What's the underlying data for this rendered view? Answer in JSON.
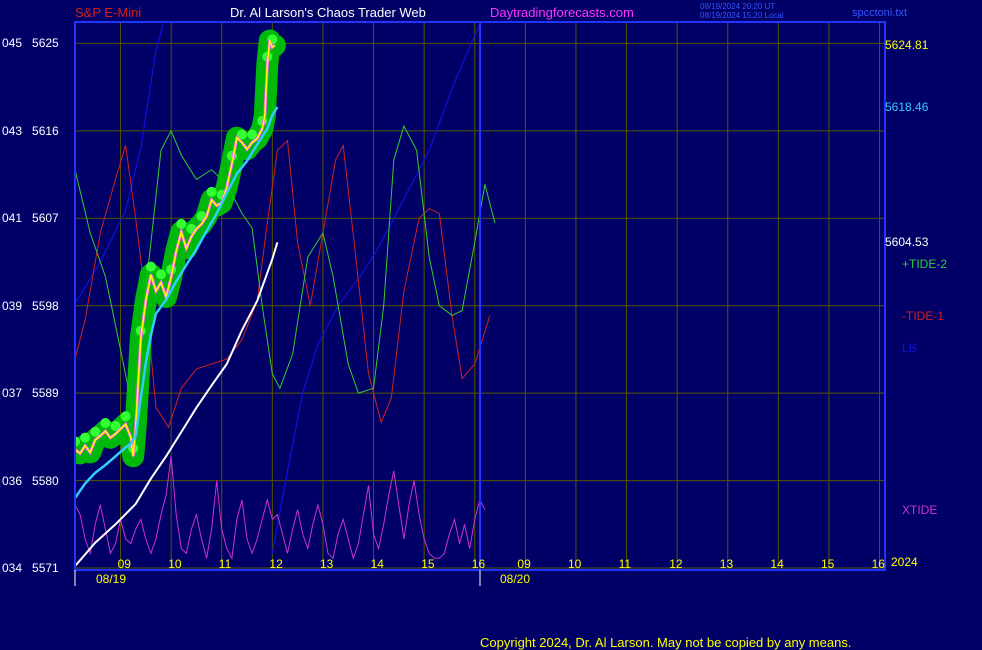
{
  "header": {
    "symbol": "S&P E-Mini",
    "title": "Dr. Al Larson's Chaos Trader Web",
    "site": "Daytradingforecasts.com",
    "time_utc": "08/19/2024 20:20 UT",
    "time_local": "08/19/2024 15:20 Local",
    "file": "spcctoni.txt"
  },
  "footer": {
    "copyright": "Copyright 2024, Dr. Al Larson. May not be copied by any means."
  },
  "colors": {
    "background": "#000066",
    "frame": "#2233ff",
    "grid": "#555500",
    "price": "#ffff00",
    "price_band": "#00cc00",
    "fast_ma": "#33ccff",
    "slow_ma": "#ffffff",
    "tide_plus2": "#33cc33",
    "tide_minus1": "#cc2222",
    "lb": "#1111dd",
    "xtide": "#cc33cc"
  },
  "chart_data": {
    "type": "line",
    "title": "S&P E-Mini",
    "ylim": [
      5571,
      5627
    ],
    "y_ticks": [
      {
        "left": "045",
        "right": "5625",
        "value": 5625
      },
      {
        "left": "043",
        "right": "5616",
        "value": 5616
      },
      {
        "left": "041",
        "right": "5607",
        "value": 5607
      },
      {
        "left": "039",
        "right": "5598",
        "value": 5598
      },
      {
        "left": "037",
        "right": "5589",
        "value": 5589
      },
      {
        "left": "036",
        "right": "5580",
        "value": 5580
      },
      {
        "left": "034",
        "right": "5571",
        "value": 5571
      }
    ],
    "x_hours": [
      "09",
      "10",
      "11",
      "12",
      "13",
      "14",
      "15",
      "16",
      "09",
      "10",
      "11",
      "12",
      "13",
      "14",
      "15",
      "16"
    ],
    "dates": [
      "08/19",
      "08/20"
    ],
    "year": "2024",
    "last_values": [
      {
        "text": "5624.81",
        "color": "#ffff00",
        "value": 5624.81
      },
      {
        "text": "5618.46",
        "color": "#33ccff",
        "value": 5618.46
      },
      {
        "text": "5604.53",
        "color": "#ffffff",
        "value": 5604.53
      }
    ],
    "series_labels": [
      {
        "text": "+TIDE-2",
        "color": "#33cc33"
      },
      {
        "text": "-TIDE-1",
        "color": "#cc2222"
      },
      {
        "text": "LB",
        "color": "#1111dd"
      },
      {
        "text": "XTIDE",
        "color": "#cc33cc"
      }
    ],
    "price": [
      [
        0,
        5583.2
      ],
      [
        0.1,
        5582.8
      ],
      [
        0.2,
        5583.6
      ],
      [
        0.3,
        5582.9
      ],
      [
        0.4,
        5584.2
      ],
      [
        0.5,
        5584.6
      ],
      [
        0.6,
        5585.1
      ],
      [
        0.7,
        5584.4
      ],
      [
        0.8,
        5584.8
      ],
      [
        0.9,
        5585.3
      ],
      [
        1.0,
        5585.8
      ],
      [
        1.1,
        5584.5
      ],
      [
        1.15,
        5582.5
      ],
      [
        1.2,
        5585.6
      ],
      [
        1.3,
        5594.6
      ],
      [
        1.4,
        5598.5
      ],
      [
        1.5,
        5601.2
      ],
      [
        1.6,
        5599.5
      ],
      [
        1.7,
        5600.4
      ],
      [
        1.8,
        5598.9
      ],
      [
        1.9,
        5600.9
      ],
      [
        2.0,
        5603.6
      ],
      [
        2.1,
        5605.6
      ],
      [
        2.2,
        5603.9
      ],
      [
        2.3,
        5605.1
      ],
      [
        2.4,
        5605.9
      ],
      [
        2.5,
        5606.4
      ],
      [
        2.6,
        5607.2
      ],
      [
        2.7,
        5608.9
      ],
      [
        2.8,
        5608.3
      ],
      [
        2.9,
        5608.6
      ],
      [
        3.0,
        5610.2
      ],
      [
        3.1,
        5612.6
      ],
      [
        3.2,
        5615.3
      ],
      [
        3.3,
        5614.8
      ],
      [
        3.4,
        5614.1
      ],
      [
        3.5,
        5614.8
      ],
      [
        3.6,
        5615.2
      ],
      [
        3.7,
        5616.2
      ],
      [
        3.75,
        5617.5
      ],
      [
        3.8,
        5622.8
      ],
      [
        3.85,
        5625.3
      ],
      [
        3.9,
        5624.6
      ],
      [
        3.95,
        5624.8
      ]
    ],
    "fast_ma": [
      [
        0,
        5578.2
      ],
      [
        0.2,
        5579.7
      ],
      [
        0.4,
        5580.8
      ],
      [
        0.6,
        5581.6
      ],
      [
        0.8,
        5582.5
      ],
      [
        1.0,
        5583.4
      ],
      [
        1.1,
        5583.8
      ],
      [
        1.2,
        5584.6
      ],
      [
        1.3,
        5588.5
      ],
      [
        1.4,
        5592.1
      ],
      [
        1.5,
        5595.0
      ],
      [
        1.6,
        5597.2
      ],
      [
        1.8,
        5598.6
      ],
      [
        2.0,
        5600.5
      ],
      [
        2.2,
        5602.2
      ],
      [
        2.4,
        5603.8
      ],
      [
        2.6,
        5605.7
      ],
      [
        2.8,
        5607.5
      ],
      [
        3.0,
        5609.6
      ],
      [
        3.2,
        5611.6
      ],
      [
        3.4,
        5612.9
      ],
      [
        3.6,
        5614.6
      ],
      [
        3.8,
        5616.2
      ],
      [
        3.9,
        5617.6
      ],
      [
        4.0,
        5618.46
      ]
    ],
    "slow_ma": [
      [
        0,
        5571.2
      ],
      [
        0.4,
        5573.6
      ],
      [
        0.8,
        5575.5
      ],
      [
        1.2,
        5577.6
      ],
      [
        1.5,
        5580.2
      ],
      [
        1.8,
        5582.5
      ],
      [
        2.1,
        5585.0
      ],
      [
        2.4,
        5587.5
      ],
      [
        2.7,
        5589.8
      ],
      [
        3.0,
        5592.0
      ],
      [
        3.3,
        5595.5
      ],
      [
        3.6,
        5598.5
      ],
      [
        3.9,
        5602.8
      ],
      [
        4.0,
        5604.53
      ]
    ],
    "lb": [
      [
        0,
        5598.2
      ],
      [
        0.5,
        5602.5
      ],
      [
        1.0,
        5607.8
      ],
      [
        1.3,
        5614.2
      ],
      [
        1.6,
        5624.3
      ],
      [
        2.0,
        5632.0
      ],
      [
        2.4,
        5638.0
      ],
      [
        2.7,
        5644.0
      ],
      [
        3.3,
        5651.0
      ],
      [
        3.6,
        5657.0
      ],
      [
        3.9,
        5662.0
      ],
      [
        3.9,
        5572.5
      ],
      [
        4.2,
        5581.0
      ],
      [
        4.5,
        5589.0
      ],
      [
        4.8,
        5594.0
      ],
      [
        5.2,
        5598.0
      ],
      [
        5.7,
        5601.5
      ],
      [
        6.0,
        5604.0
      ],
      [
        6.3,
        5607.0
      ],
      [
        6.6,
        5610.0
      ],
      [
        7.0,
        5614.0
      ],
      [
        7.5,
        5621.0
      ],
      [
        8.0,
        5627.0
      ]
    ],
    "tide_plus2": [
      [
        0,
        5612.0
      ],
      [
        0.3,
        5605.5
      ],
      [
        0.6,
        5601.0
      ],
      [
        0.9,
        5593.5
      ],
      [
        1.15,
        5587.0
      ],
      [
        1.3,
        5595.5
      ],
      [
        1.5,
        5604.5
      ],
      [
        1.7,
        5614.0
      ],
      [
        1.9,
        5616.0
      ],
      [
        2.1,
        5613.5
      ],
      [
        2.4,
        5611.0
      ],
      [
        2.7,
        5612.0
      ],
      [
        3.0,
        5610.5
      ],
      [
        3.3,
        5607.5
      ],
      [
        3.5,
        5606.0
      ],
      [
        3.7,
        5598.0
      ],
      [
        3.9,
        5591.0
      ],
      [
        4.05,
        5589.5
      ],
      [
        4.3,
        5593.0
      ],
      [
        4.6,
        5603.0
      ],
      [
        4.9,
        5605.5
      ],
      [
        5.1,
        5601.0
      ],
      [
        5.4,
        5592.0
      ],
      [
        5.6,
        5589.0
      ],
      [
        5.9,
        5589.5
      ],
      [
        6.1,
        5598.0
      ],
      [
        6.3,
        5613.0
      ],
      [
        6.5,
        5616.5
      ],
      [
        6.75,
        5614.0
      ],
      [
        7.0,
        5603.0
      ],
      [
        7.2,
        5598.0
      ],
      [
        7.45,
        5597.0
      ],
      [
        7.65,
        5597.5
      ],
      [
        7.9,
        5604.5
      ],
      [
        8.1,
        5610.5
      ],
      [
        8.3,
        5606.5
      ]
    ],
    "tide_minus1": [
      [
        0,
        5592.5
      ],
      [
        0.2,
        5596.5
      ],
      [
        0.5,
        5605.5
      ],
      [
        0.8,
        5611.0
      ],
      [
        1.0,
        5614.5
      ],
      [
        1.2,
        5607.0
      ],
      [
        1.4,
        5598.5
      ],
      [
        1.6,
        5587.5
      ],
      [
        1.85,
        5585.5
      ],
      [
        2.1,
        5589.5
      ],
      [
        2.4,
        5591.5
      ],
      [
        2.7,
        5592.0
      ],
      [
        3.0,
        5592.5
      ],
      [
        3.3,
        5594.5
      ],
      [
        3.6,
        5598.5
      ],
      [
        3.8,
        5606.5
      ],
      [
        4.0,
        5614.0
      ],
      [
        4.2,
        5615.0
      ],
      [
        4.4,
        5604.5
      ],
      [
        4.65,
        5598.0
      ],
      [
        4.9,
        5605.5
      ],
      [
        5.15,
        5613.0
      ],
      [
        5.3,
        5614.5
      ],
      [
        5.55,
        5603.0
      ],
      [
        5.8,
        5591.0
      ],
      [
        6.05,
        5586.0
      ],
      [
        6.25,
        5588.5
      ],
      [
        6.5,
        5599.5
      ],
      [
        6.8,
        5607.0
      ],
      [
        7.0,
        5608.0
      ],
      [
        7.2,
        5607.5
      ],
      [
        7.45,
        5597.0
      ],
      [
        7.65,
        5590.5
      ],
      [
        7.9,
        5592.0
      ],
      [
        8.2,
        5597.0
      ]
    ],
    "xtide": [
      [
        0,
        5577.5
      ],
      [
        0.1,
        5576.5
      ],
      [
        0.2,
        5574.0
      ],
      [
        0.3,
        5572.5
      ],
      [
        0.4,
        5575.5
      ],
      [
        0.5,
        5577.5
      ],
      [
        0.6,
        5575.0
      ],
      [
        0.7,
        5572.5
      ],
      [
        0.8,
        5573.5
      ],
      [
        0.9,
        5576.0
      ],
      [
        1.0,
        5574.0
      ],
      [
        1.1,
        5573.5
      ],
      [
        1.2,
        5575.0
      ],
      [
        1.3,
        5576.0
      ],
      [
        1.4,
        5574.0
      ],
      [
        1.5,
        5572.5
      ],
      [
        1.6,
        5574.0
      ],
      [
        1.7,
        5576.5
      ],
      [
        1.8,
        5578.5
      ],
      [
        1.9,
        5582.5
      ],
      [
        2.0,
        5576.5
      ],
      [
        2.1,
        5573.0
      ],
      [
        2.2,
        5572.5
      ],
      [
        2.3,
        5575.0
      ],
      [
        2.4,
        5576.5
      ],
      [
        2.5,
        5574.0
      ],
      [
        2.6,
        5572.0
      ],
      [
        2.7,
        5575.0
      ],
      [
        2.8,
        5580.0
      ],
      [
        2.9,
        5575.0
      ],
      [
        3.0,
        5573.0
      ],
      [
        3.1,
        5572.0
      ],
      [
        3.2,
        5576.0
      ],
      [
        3.3,
        5578.0
      ],
      [
        3.4,
        5574.0
      ],
      [
        3.5,
        5572.5
      ],
      [
        3.6,
        5574.0
      ],
      [
        3.7,
        5576.0
      ],
      [
        3.8,
        5578.0
      ],
      [
        3.9,
        5576.0
      ],
      [
        4.0,
        5576.5
      ],
      [
        4.1,
        5574.5
      ],
      [
        4.2,
        5572.5
      ],
      [
        4.3,
        5575.0
      ],
      [
        4.4,
        5577.0
      ],
      [
        4.5,
        5574.5
      ],
      [
        4.6,
        5573.0
      ],
      [
        4.7,
        5575.5
      ],
      [
        4.8,
        5577.5
      ],
      [
        4.9,
        5575.5
      ],
      [
        5.0,
        5572.5
      ],
      [
        5.1,
        5572.0
      ],
      [
        5.2,
        5574.5
      ],
      [
        5.3,
        5576.0
      ],
      [
        5.4,
        5574.0
      ],
      [
        5.5,
        5572.0
      ],
      [
        5.6,
        5573.5
      ],
      [
        5.7,
        5576.5
      ],
      [
        5.8,
        5579.5
      ],
      [
        5.9,
        5574.5
      ],
      [
        6.0,
        5573.0
      ],
      [
        6.1,
        5575.5
      ],
      [
        6.2,
        5578.5
      ],
      [
        6.3,
        5581.0
      ],
      [
        6.4,
        5577.5
      ],
      [
        6.5,
        5574.0
      ],
      [
        6.6,
        5577.5
      ],
      [
        6.7,
        5580.0
      ],
      [
        6.8,
        5576.5
      ],
      [
        6.9,
        5574.0
      ],
      [
        7.0,
        5572.5
      ],
      [
        7.1,
        5572.0
      ],
      [
        7.2,
        5572.0
      ],
      [
        7.3,
        5572.5
      ],
      [
        7.4,
        5574.5
      ],
      [
        7.5,
        5576.0
      ],
      [
        7.6,
        5573.5
      ],
      [
        7.7,
        5575.5
      ],
      [
        7.8,
        5573.0
      ],
      [
        7.9,
        5576.0
      ],
      [
        8.0,
        5578.0
      ],
      [
        8.1,
        5577.0
      ]
    ]
  }
}
